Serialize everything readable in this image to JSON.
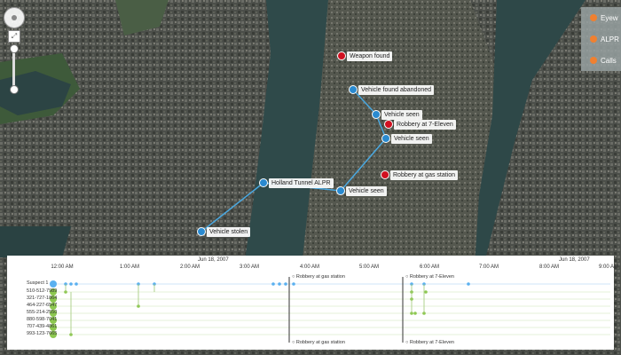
{
  "map": {
    "markers": [
      {
        "id": "weapon-found",
        "label": "Weapon found",
        "kind": "incident",
        "color": "#d01020"
      },
      {
        "id": "vehicle-found-abandoned",
        "label": "Vehicle found abandoned",
        "kind": "vehicle",
        "color": "#2a8ad0"
      },
      {
        "id": "vehicle-seen-1",
        "label": "Vehicle seen",
        "kind": "vehicle",
        "color": "#2a8ad0"
      },
      {
        "id": "robbery-7eleven",
        "label": "Robbery at 7-Eleven",
        "kind": "incident",
        "color": "#d01020"
      },
      {
        "id": "vehicle-seen-2",
        "label": "Vehicle seen",
        "kind": "vehicle",
        "color": "#2a8ad0"
      },
      {
        "id": "robbery-gas-station",
        "label": "Robbery at gas station",
        "kind": "incident",
        "color": "#d01020"
      },
      {
        "id": "holland-tunnel-alpr",
        "label": "Holland Tunnel ALPR",
        "kind": "vehicle",
        "color": "#2a8ad0"
      },
      {
        "id": "vehicle-seen-3",
        "label": "Vehicle seen",
        "kind": "vehicle",
        "color": "#2a8ad0"
      },
      {
        "id": "vehicle-stolen",
        "label": "Vehicle stolen",
        "kind": "vehicle",
        "color": "#2a8ad0"
      }
    ],
    "route_color": "#4aa8e0",
    "legend": [
      {
        "label": "Eyew",
        "icon": "eye-icon"
      },
      {
        "label": "ALPR",
        "icon": "car-icon"
      },
      {
        "label": "Calls",
        "icon": "phone-icon"
      }
    ]
  },
  "timebar": {
    "dates": [
      "Jun 18, 2007",
      "Jun 18, 2007"
    ],
    "ticks": [
      "12:00 AM",
      "1:00 AM",
      "2:00 AM",
      "3:00 AM",
      "4:00 AM",
      "5:00 AM",
      "6:00 AM",
      "7:00 AM",
      "8:00 AM",
      "9:00 AM"
    ],
    "rows": [
      {
        "label": "Suspect 1",
        "color": "#5ab0f0"
      },
      {
        "label": "510-512-7989",
        "color": "#8dc850"
      },
      {
        "label": "321-727-1864",
        "color": "#8dc850"
      },
      {
        "label": "464-227-6547",
        "color": "#8dc850"
      },
      {
        "label": "555-214-2550",
        "color": "#8dc850"
      },
      {
        "label": "880-598-7041",
        "color": "#8dc850"
      },
      {
        "label": "707-439-4861",
        "color": "#8dc850"
      },
      {
        "label": "993-123-7665",
        "color": "#8dc850"
      }
    ],
    "events": [
      {
        "label": "Robbery at gas station",
        "position": "top"
      },
      {
        "label": "Robbery at gas station",
        "position": "bottom"
      },
      {
        "label": "Robbery at 7-Eleven",
        "position": "top"
      },
      {
        "label": "Robbery at 7-Eleven",
        "position": "bottom"
      }
    ]
  }
}
